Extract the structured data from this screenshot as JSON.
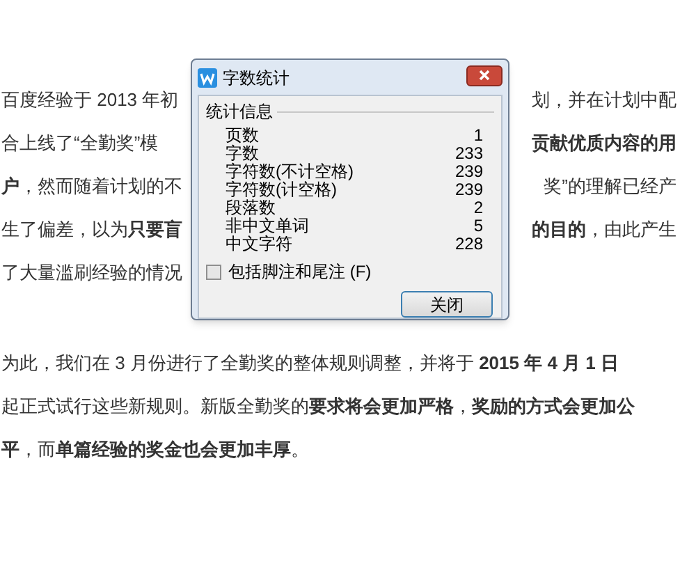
{
  "document": {
    "paragraphs": [
      {
        "lines": [
          {
            "left": "百度经验于 2013 年初",
            "right": "划，并在计划中配"
          },
          {
            "left": "合上线了“全勤奖”模",
            "right": "**贡献优质内容的用**"
          },
          {
            "left": "**户**，然而随着计划的不",
            "right": "奖”的理解已经产"
          },
          {
            "left": "生了偏差，以为**只要盲**",
            "right": "**的目的**，由此产生"
          },
          {
            "left": "了大量滥刷经验的情况"
          }
        ]
      },
      {
        "lines": [
          {
            "left": "为此，我们在 3 月份进行了全勤奖的整体规则调整，并将于 **2015 年 4 月 1 日**"
          },
          {
            "left": "起正式试行这些新规则。新版全勤奖的**要求将会更加严格**，**奖励的方式会更加公**"
          },
          {
            "left": "**平**，而**单篇经验的奖金也会更加丰厚**。"
          }
        ]
      }
    ]
  },
  "dialog": {
    "title": "字数统计",
    "section": "统计信息",
    "stats": [
      {
        "label": "页数",
        "value": "1"
      },
      {
        "label": "字数",
        "value": "233"
      },
      {
        "label": "字符数(不计空格)",
        "value": "239"
      },
      {
        "label": "字符数(计空格)",
        "value": "239"
      },
      {
        "label": "段落数",
        "value": "2"
      },
      {
        "label": "非中文单词",
        "value": "5"
      },
      {
        "label": "中文字符",
        "value": "228"
      }
    ],
    "checkbox": {
      "label": "包括脚注和尾注 (F)",
      "checked": false
    },
    "button": "关闭"
  }
}
